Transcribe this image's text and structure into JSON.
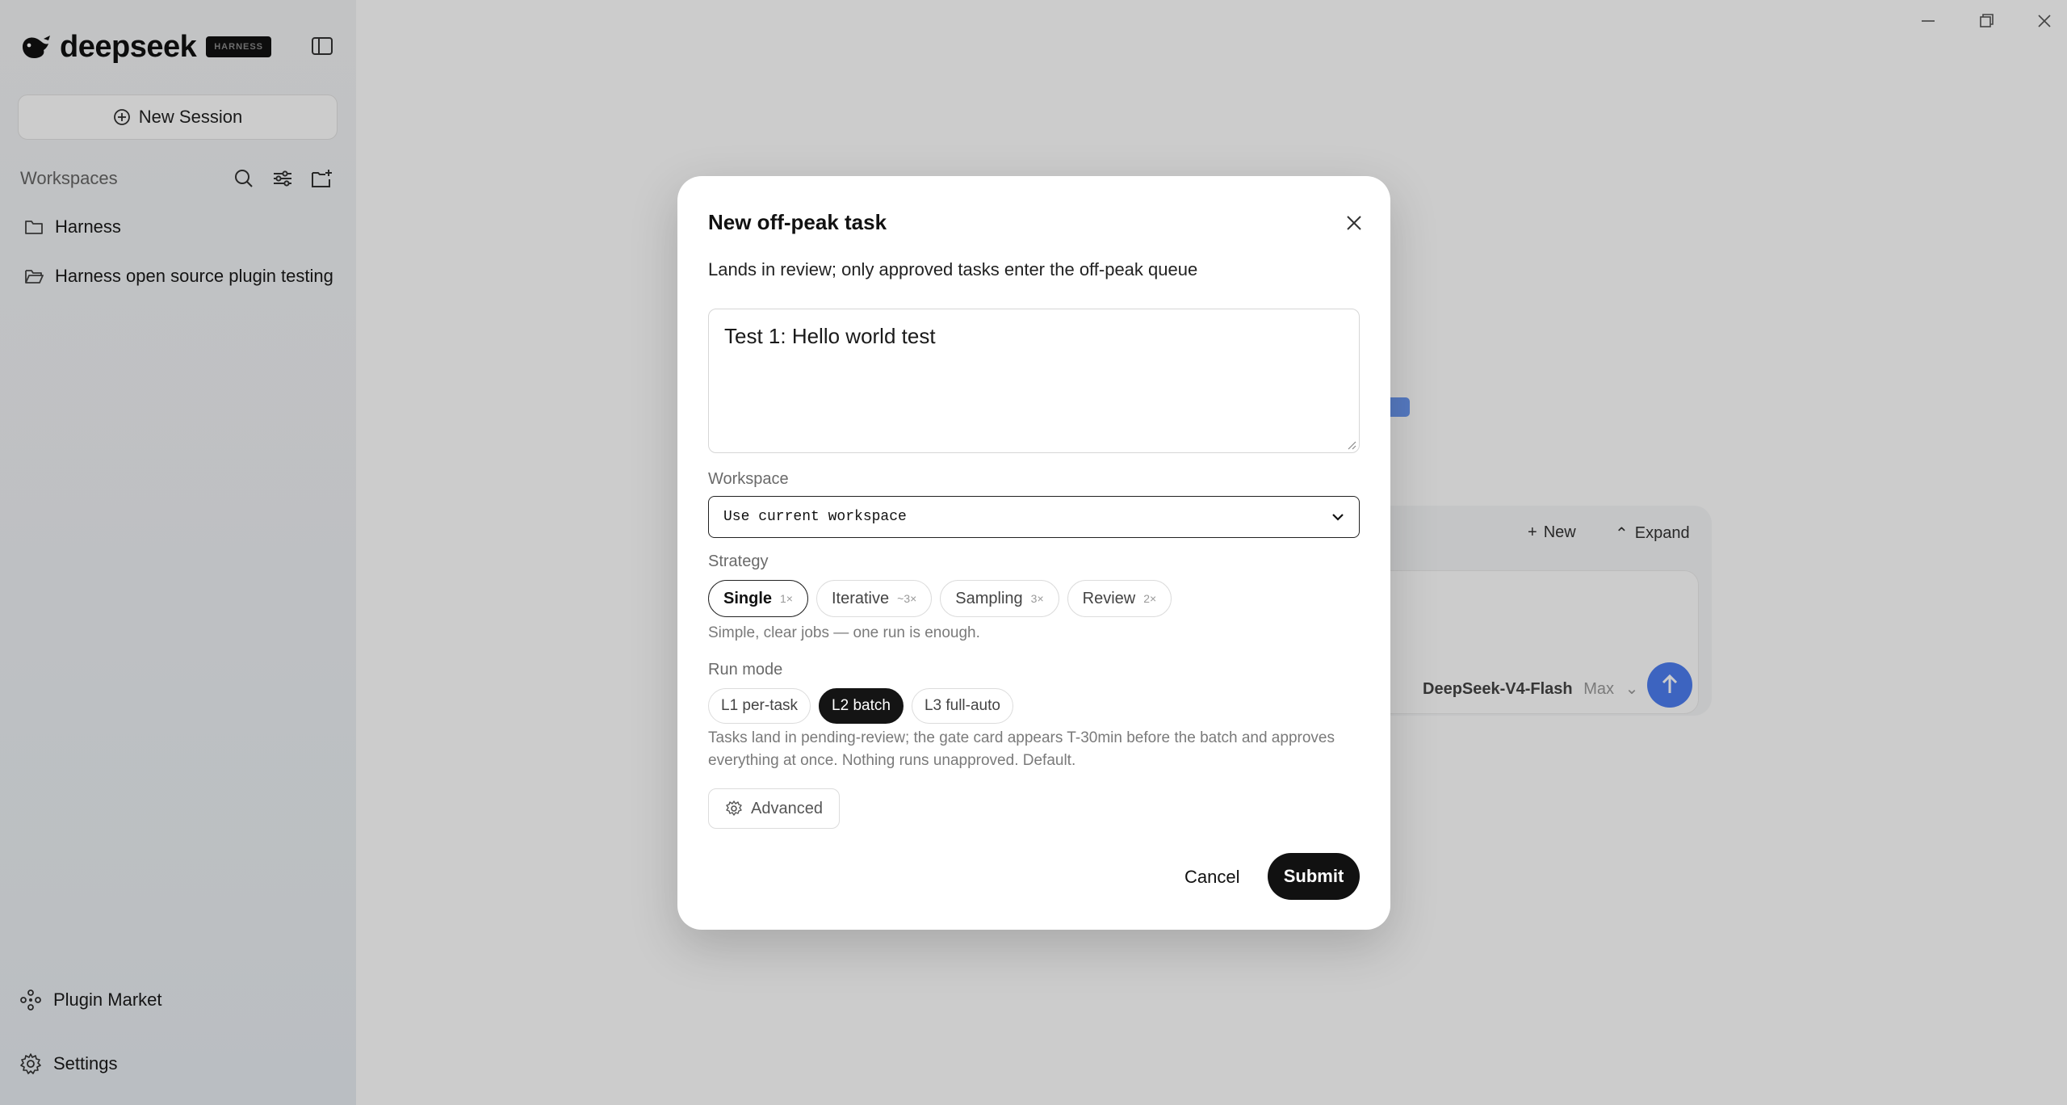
{
  "app": {
    "logo_text": "deepseek",
    "logo_badge": "HARNESS"
  },
  "sidebar": {
    "new_session_label": "New Session",
    "workspaces_label": "Workspaces",
    "workspaces": [
      {
        "label": "Harness",
        "icon": "folder-icon"
      },
      {
        "label": "Harness open source plugin testing",
        "icon": "folder-open-icon"
      }
    ],
    "plugin_market_label": "Plugin Market",
    "settings_label": "Settings"
  },
  "background": {
    "new_label": "New",
    "expand_label": "Expand",
    "model_name": "DeepSeek-V4-Flash",
    "model_mode": "Max"
  },
  "modal": {
    "title": "New off-peak task",
    "subtitle": "Lands in review; only approved tasks enter the off-peak queue",
    "task_text": "Test 1: Hello world test",
    "workspace_label": "Workspace",
    "workspace_value": "Use current workspace",
    "strategy_label": "Strategy",
    "strategies": [
      {
        "label": "Single",
        "mult": "1×",
        "selected": true
      },
      {
        "label": "Iterative",
        "mult": "~3×",
        "selected": false
      },
      {
        "label": "Sampling",
        "mult": "3×",
        "selected": false
      },
      {
        "label": "Review",
        "mult": "2×",
        "selected": false
      }
    ],
    "strategy_hint": "Simple, clear jobs — one run is enough.",
    "run_mode_label": "Run mode",
    "run_modes": [
      {
        "label": "L1 per-task",
        "selected": false
      },
      {
        "label": "L2 batch",
        "selected": true
      },
      {
        "label": "L3 full-auto",
        "selected": false
      }
    ],
    "run_mode_hint": "Tasks land in pending-review; the gate card appears T-30min before the batch and approves everything at once. Nothing runs unapproved. Default.",
    "advanced_label": "Advanced",
    "cancel_label": "Cancel",
    "submit_label": "Submit"
  },
  "colors": {
    "primary": "#111111",
    "accent_blue": "#4d7ef0",
    "overlay": "rgba(0,0,0,0.2)"
  }
}
